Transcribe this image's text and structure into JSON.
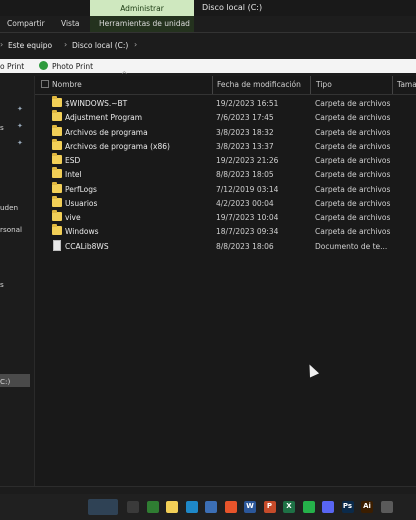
{
  "window": {
    "title": "Disco local (C:)",
    "contextual_tab": "Administrar"
  },
  "ribbon": {
    "tabs": [
      "Compartir",
      "Vista",
      "Herramientas de unidad"
    ]
  },
  "address": {
    "crumbs": [
      "Este equipo",
      "Disco local (C:)"
    ]
  },
  "quickbar": {
    "left_text": "o Print",
    "right_text": "Photo Print"
  },
  "nav": {
    "items": [
      {
        "label": "s"
      },
      {
        "label": "uden"
      },
      {
        "label": "rsonal"
      },
      {
        "label": "s"
      },
      {
        "label": "C:)",
        "selected": true
      }
    ]
  },
  "columns": {
    "name": "Nombre",
    "date": "Fecha de modificación",
    "type": "Tipo",
    "size": "Tama"
  },
  "files": [
    {
      "name": "$WINDOWS.~BT",
      "date": "19/2/2023 16:51",
      "type": "Carpeta de archivos",
      "kind": "folder"
    },
    {
      "name": "Adjustment Program",
      "date": "7/6/2023 17:45",
      "type": "Carpeta de archivos",
      "kind": "folder"
    },
    {
      "name": "Archivos de programa",
      "date": "3/8/2023 18:32",
      "type": "Carpeta de archivos",
      "kind": "folder"
    },
    {
      "name": "Archivos de programa (x86)",
      "date": "3/8/2023 13:37",
      "type": "Carpeta de archivos",
      "kind": "folder"
    },
    {
      "name": "ESD",
      "date": "19/2/2023 21:26",
      "type": "Carpeta de archivos",
      "kind": "folder"
    },
    {
      "name": "Intel",
      "date": "8/8/2023 18:05",
      "type": "Carpeta de archivos",
      "kind": "folder"
    },
    {
      "name": "PerfLogs",
      "date": "7/12/2019 03:14",
      "type": "Carpeta de archivos",
      "kind": "folder"
    },
    {
      "name": "Usuarios",
      "date": "4/2/2023 00:04",
      "type": "Carpeta de archivos",
      "kind": "folder"
    },
    {
      "name": "vive",
      "date": "19/7/2023 10:04",
      "type": "Carpeta de archivos",
      "kind": "folder"
    },
    {
      "name": "Windows",
      "date": "18/7/2023 09:34",
      "type": "Carpeta de archivos",
      "kind": "folder"
    },
    {
      "name": "CCALib8WS",
      "date": "8/8/2023 18:06",
      "type": "Documento de te...",
      "kind": "file"
    }
  ],
  "taskbar": {
    "apps": [
      {
        "icon": "task-view-icon",
        "color": "#3a3a3a",
        "text": ""
      },
      {
        "icon": "chrome-icon",
        "color": "#2f7d32",
        "text": ""
      },
      {
        "icon": "file-explorer-icon",
        "color": "#f2cf57",
        "text": ""
      },
      {
        "icon": "edge-icon",
        "color": "#1e88c8",
        "text": ""
      },
      {
        "icon": "store-icon",
        "color": "#3c6fb5",
        "text": ""
      },
      {
        "icon": "brave-icon",
        "color": "#e8542b",
        "text": ""
      },
      {
        "icon": "word-icon",
        "color": "#2b579a",
        "text": "W"
      },
      {
        "icon": "powerpoint-icon",
        "color": "#c64b2a",
        "text": "P"
      },
      {
        "icon": "excel-icon",
        "color": "#1e7145",
        "text": "X"
      },
      {
        "icon": "whatsapp-icon",
        "color": "#25b14a",
        "text": ""
      },
      {
        "icon": "discord-icon",
        "color": "#5865f2",
        "text": ""
      },
      {
        "icon": "photoshop-icon",
        "color": "#0b2a4a",
        "text": "Ps"
      },
      {
        "icon": "illustrator-icon",
        "color": "#3a1d00",
        "text": "Ai"
      },
      {
        "icon": "app-icon",
        "color": "#5a5a5a",
        "text": ""
      }
    ]
  }
}
